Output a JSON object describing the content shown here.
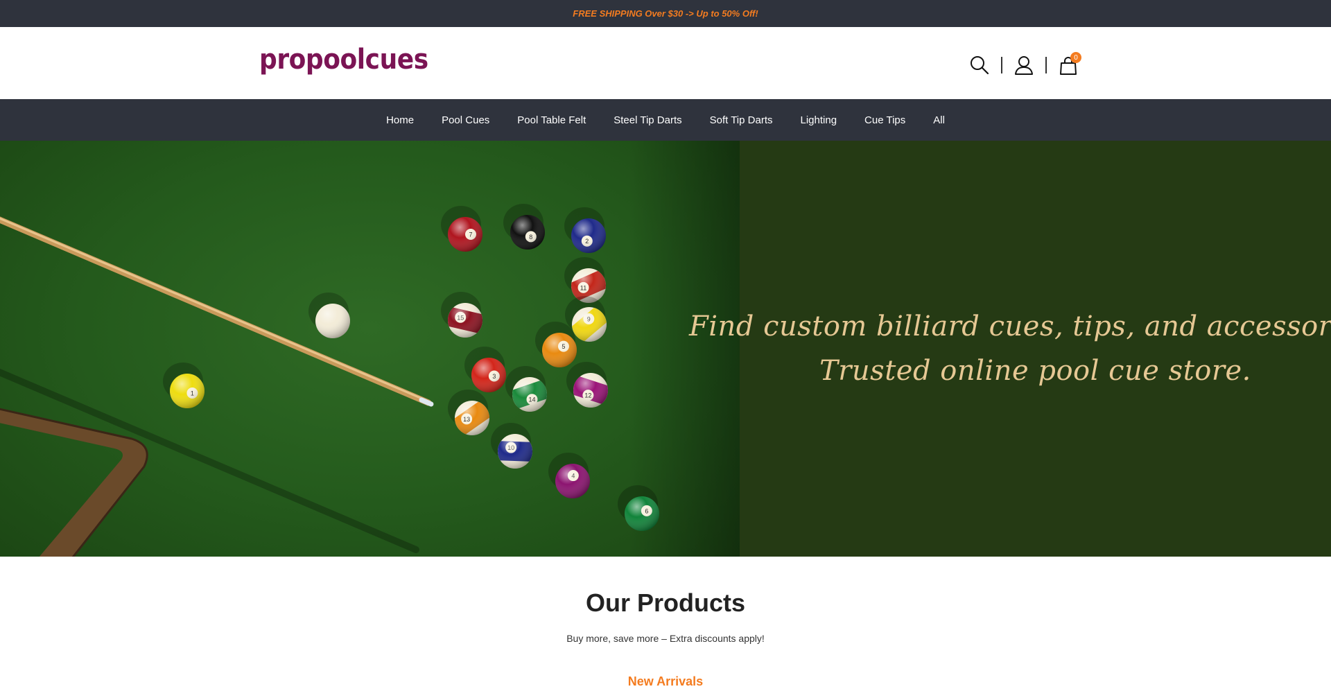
{
  "announcement": {
    "text": "FREE SHIPPING Over $30 -> Up to 50% Off!"
  },
  "header": {
    "logo": "propoolcues",
    "icons": [
      "search-icon",
      "user-icon",
      "cart-icon"
    ],
    "cart_count": "0"
  },
  "nav": {
    "items": [
      {
        "label": "Home"
      },
      {
        "label": "Pool Cues"
      },
      {
        "label": "Pool Table Felt"
      },
      {
        "label": "Steel Tip Darts"
      },
      {
        "label": "Soft Tip Darts"
      },
      {
        "label": "Lighting"
      },
      {
        "label": "Cue Tips"
      },
      {
        "label": "All"
      }
    ]
  },
  "hero": {
    "line1": "Find custom billiard cues, tips, and accessories.",
    "line2": "Trusted online pool cue store."
  },
  "products": {
    "title": "Our Products",
    "subtitle": "Buy more, save more – Extra discounts apply!",
    "new_arrivals": "New Arrivals"
  },
  "colors": {
    "dark_bar": "#2f333d",
    "accent_orange": "#f47c20",
    "logo_purple": "#7b1454",
    "hero_green": "#253a14",
    "hero_text": "#e6c894"
  },
  "hero_image": {
    "balls": [
      {
        "number": "7",
        "color": "#b0151f",
        "striped": false
      },
      {
        "number": "8",
        "color": "#111111",
        "striped": false
      },
      {
        "number": "2",
        "color": "#1f2a8a",
        "striped": false
      },
      {
        "number": "11",
        "color": "#c3261a",
        "striped": true
      },
      {
        "number": "15",
        "color": "#8d1321",
        "striped": true
      },
      {
        "number": "9",
        "color": "#f0d712",
        "striped": true
      },
      {
        "number": "5",
        "color": "#e98a10",
        "striped": false
      },
      {
        "number": "3",
        "color": "#d3251a",
        "striped": false
      },
      {
        "number": "14",
        "color": "#1a8a3a",
        "striped": true
      },
      {
        "number": "12",
        "color": "#9b1478",
        "striped": true
      },
      {
        "number": "13",
        "color": "#e98a10",
        "striped": true
      },
      {
        "number": "10",
        "color": "#1f2a8a",
        "striped": true
      },
      {
        "number": "4",
        "color": "#8c1470",
        "striped": false
      },
      {
        "number": "6",
        "color": "#11843a",
        "striped": false
      },
      {
        "number": "1",
        "color": "#eedd10",
        "striped": false
      },
      {
        "number": "",
        "color": "#f3ecd8",
        "striped": false
      }
    ]
  }
}
